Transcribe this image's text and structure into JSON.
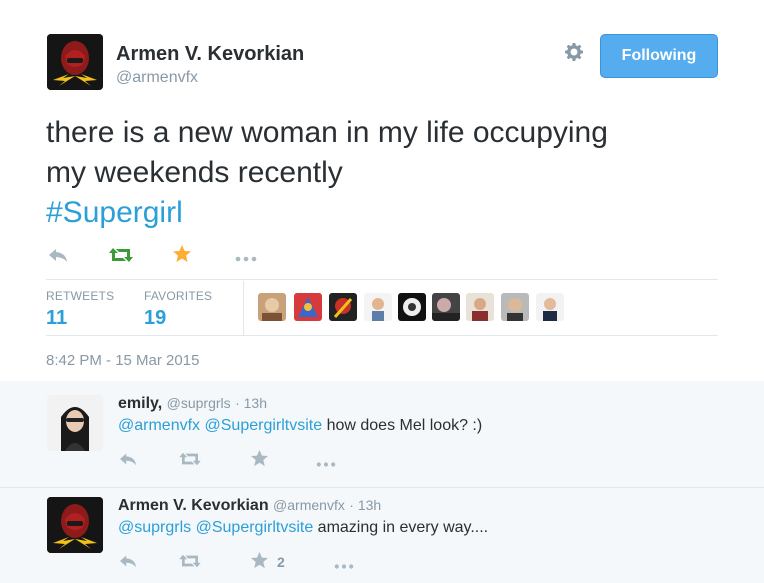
{
  "tweet": {
    "author_name": "Armen V. Kevorkian",
    "author_handle": "@armenvfx",
    "follow_label": "Following",
    "text_line1": "there is a new woman in my life occupying",
    "text_line2": "my weekends recently",
    "hashtag": "#Supergirl",
    "stats": {
      "retweets_label": "RETWEETS",
      "retweets_value": "11",
      "favorites_label": "FAVORITES",
      "favorites_value": "19"
    },
    "timestamp": "8:42 PM - 15 Mar 2015",
    "icons": {
      "reply": "reply-icon",
      "retweet": "retweet-icon",
      "favorite": "star-icon",
      "more": "more-icon",
      "settings": "gear-icon"
    }
  },
  "replies": [
    {
      "name": "emily,",
      "handle": "@suprgrls",
      "time": "· 13h",
      "mention1": "@armenvfx",
      "mention2": "@Supergirltvsite",
      "text": " how does Mel look? :)",
      "favorite_count": ""
    },
    {
      "name": "Armen V. Kevorkian",
      "handle": "@armenvfx",
      "time": "· 13h",
      "mention1": "@suprgrls",
      "mention2": "@Supergirltvsite",
      "text": " amazing in every way....",
      "favorite_count": "2"
    }
  ],
  "colors": {
    "accent": "#2b9fd8",
    "follow_button": "#55acee",
    "retweet_green": "#3a9b3a",
    "favorite_gold": "#ffac33",
    "muted": "#8899a6"
  }
}
